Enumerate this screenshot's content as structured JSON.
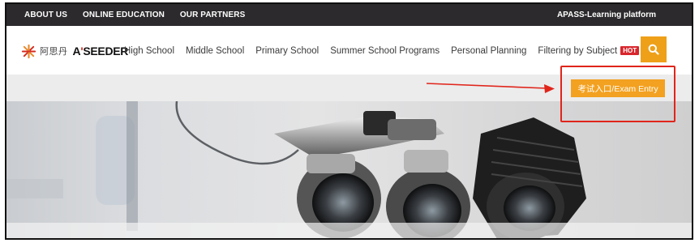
{
  "topbar": {
    "links": [
      "ABOUT US",
      "ONLINE EDUCATION",
      "OUR PARTNERS"
    ],
    "platform": "APASS-Learning platform"
  },
  "logo": {
    "cn": "阿思丹",
    "en_prefix": "A",
    "en_mark": "'",
    "en_rest": "SEEDER"
  },
  "nav": {
    "items": [
      "High School",
      "Middle School",
      "Primary School",
      "Summer School Programs",
      "Personal Planning"
    ],
    "filter_label": "Filtering by Subject",
    "hot_badge": "HOT"
  },
  "search": {
    "icon": "search-icon"
  },
  "exam_entry": {
    "label": "考试入口/Exam Entry"
  },
  "colors": {
    "topbar": "#2c2a2c",
    "accent": "#eea019",
    "highlight": "#e0251b",
    "hot": "#d8262c"
  }
}
